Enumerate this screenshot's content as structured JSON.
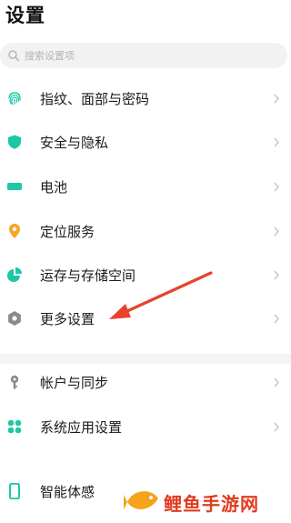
{
  "header": {
    "title": "设置"
  },
  "search": {
    "placeholder": "搜索设置项"
  },
  "items": [
    {
      "label": "指纹、面部与密码",
      "icon": "fingerprint-icon"
    },
    {
      "label": "安全与隐私",
      "icon": "shield-icon"
    },
    {
      "label": "电池",
      "icon": "battery-icon"
    },
    {
      "label": "定位服务",
      "icon": "location-pin-icon"
    },
    {
      "label": "运存与存储空间",
      "icon": "pie-chart-icon"
    },
    {
      "label": "更多设置",
      "icon": "gear-icon"
    },
    {
      "label": "帐户与同步",
      "icon": "key-icon"
    },
    {
      "label": "系统应用设置",
      "icon": "apps-grid-icon"
    },
    {
      "label": "智能体感",
      "icon": "phone-outline-icon"
    }
  ],
  "watermark": {
    "text": "鲤鱼手游网"
  },
  "colors": {
    "accent": "#1ec7a5",
    "location": "#f5a623",
    "arrow": "#e8412e",
    "watermark": "#e23a1f"
  }
}
